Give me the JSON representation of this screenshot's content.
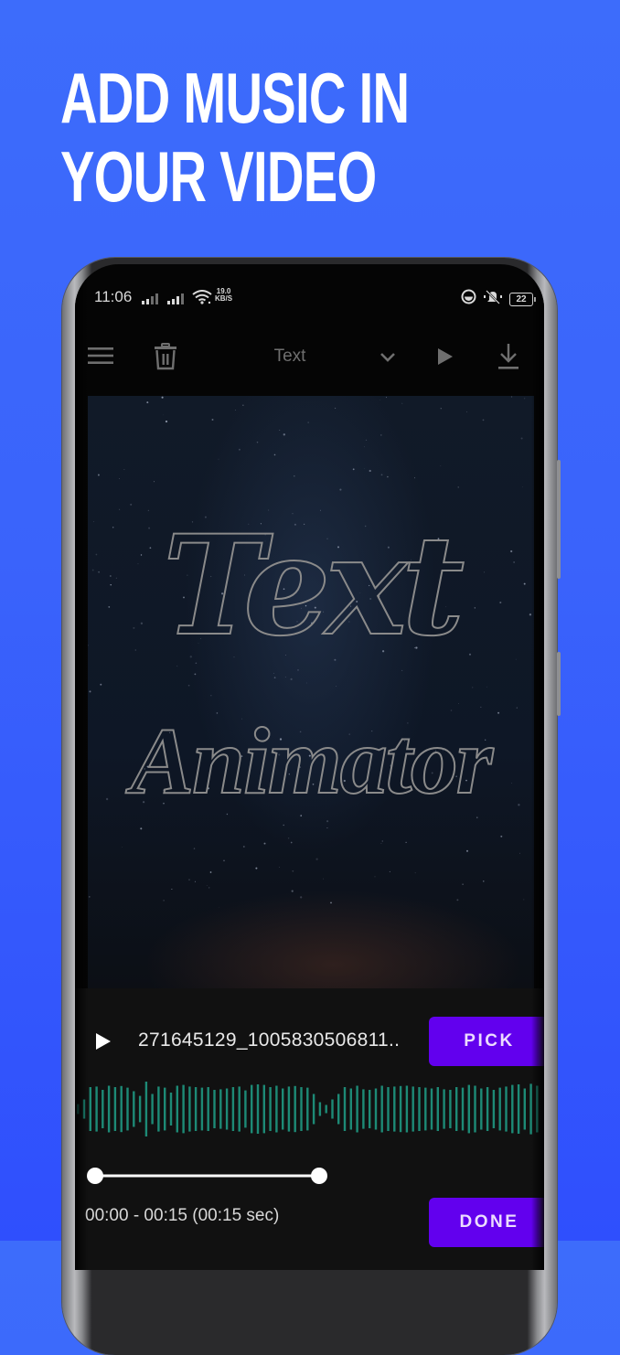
{
  "headline": {
    "line1": "ADD MUSIC IN",
    "line2": "YOUR VIDEO"
  },
  "colors": {
    "background": "#3a63fb",
    "accent_button": "#6200ee",
    "waveform": "#1d8a76",
    "panel": "#111111"
  },
  "status_bar": {
    "time": "11:06",
    "net_speed_value": "19.0",
    "net_speed_unit": "KB/S",
    "battery": "22",
    "icons": [
      "signal-icon",
      "signal-icon",
      "wifi-icon",
      "data-saver-icon",
      "mute-icon",
      "battery-icon"
    ]
  },
  "toolbar": {
    "title": "Text",
    "icons": [
      "menu-icon",
      "trash-icon",
      "chevron-down-icon",
      "play-icon",
      "download-icon"
    ]
  },
  "preview": {
    "line1": "Text",
    "line2": "Animator"
  },
  "audio": {
    "file_name": "271645129_1005830506811..",
    "pick_label": "PICK",
    "done_label": "DONE",
    "range_start": "00:00",
    "range_end": "00:15",
    "duration_text": "00:00 - 00:15 (00:15 sec)",
    "selection_fraction": [
      0.0,
      0.5
    ],
    "waveform_amplitudes": [
      0.18,
      0.35,
      0.8,
      0.82,
      0.7,
      0.85,
      0.8,
      0.84,
      0.78,
      0.65,
      0.48,
      1.0,
      0.55,
      0.82,
      0.78,
      0.6,
      0.85,
      0.88,
      0.82,
      0.8,
      0.78,
      0.8,
      0.7,
      0.72,
      0.75,
      0.8,
      0.82,
      0.68,
      0.88,
      0.9,
      0.88,
      0.8,
      0.85,
      0.75,
      0.82,
      0.84,
      0.8,
      0.78,
      0.55,
      0.25,
      0.15,
      0.35,
      0.55,
      0.8,
      0.75,
      0.85,
      0.72,
      0.7,
      0.75,
      0.85,
      0.8,
      0.82,
      0.84,
      0.85,
      0.82,
      0.8,
      0.78,
      0.75,
      0.8,
      0.72,
      0.7,
      0.8,
      0.78,
      0.88,
      0.85,
      0.75,
      0.8,
      0.7,
      0.78,
      0.82,
      0.88,
      0.9,
      0.75,
      0.92,
      0.85
    ]
  }
}
